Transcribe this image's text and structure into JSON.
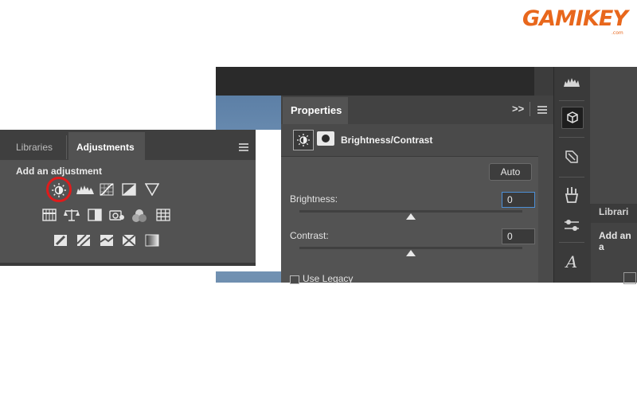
{
  "logo": {
    "text": "GAMIKEY",
    "sub": ".com"
  },
  "properties": {
    "tab_label": "Properties",
    "collapse_glyph": ">>",
    "adjustment_name": "Brightness/Contrast",
    "auto_label": "Auto",
    "brightness_label": "Brightness:",
    "brightness_value": "0",
    "brightness_level": 0.5,
    "contrast_label": "Contrast:",
    "contrast_value": "0",
    "contrast_level": 0.5,
    "use_legacy_label": "Use Legacy",
    "use_legacy_checked": false
  },
  "adjustments": {
    "tabs": [
      {
        "label": "Libraries"
      },
      {
        "label": "Adjustments",
        "active": true
      }
    ],
    "add_label": "Add an adjustment",
    "highlighted_icon": "brightness-contrast-icon",
    "highlight_color": "#e01b1b",
    "rows": [
      [
        "brightness-contrast-icon",
        "levels-icon",
        "curves-icon",
        "exposure-icon",
        "vibrance-icon"
      ],
      [
        "hue-saturation-icon",
        "color-balance-icon",
        "black-white-icon",
        "photo-filter-icon",
        "channel-mixer-icon",
        "color-lookup-icon"
      ],
      [
        "invert-icon",
        "posterize-icon",
        "threshold-icon",
        "selective-color-icon",
        "gradient-map-icon"
      ]
    ]
  },
  "right_panel": {
    "tab_label": "Librari",
    "add_label": "Add an a"
  },
  "toolbar_icons": [
    "histogram-icon",
    "3d-cube-icon",
    "paths-icon",
    "brushes-icon",
    "sliders-icon",
    "character-icon"
  ],
  "colors": {
    "accent_blue": "#4d8fd6",
    "logo_orange": "#e8671c"
  }
}
